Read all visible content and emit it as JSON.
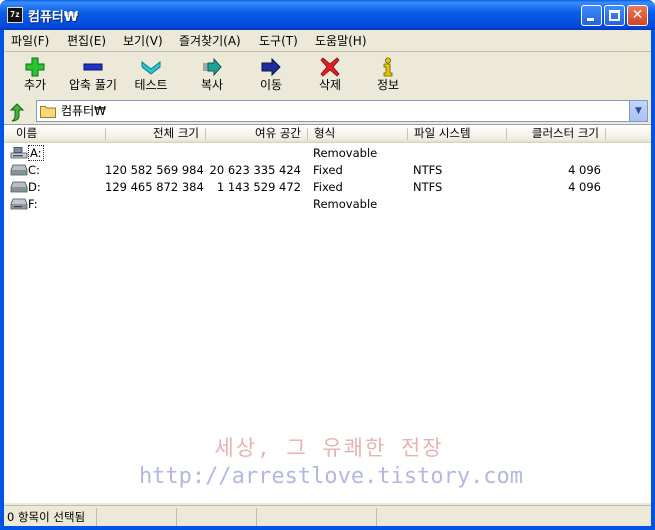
{
  "window": {
    "title": "컴퓨터₩",
    "app_icon_text": "7z"
  },
  "menu": [
    {
      "label": "파일(F)"
    },
    {
      "label": "편집(E)"
    },
    {
      "label": "보기(V)"
    },
    {
      "label": "즐겨찾기(A)"
    },
    {
      "label": "도구(T)"
    },
    {
      "label": "도움말(H)"
    }
  ],
  "toolbar": [
    {
      "label": "추가",
      "icon": "add-icon",
      "color": "#22b02a"
    },
    {
      "label": "압축 풀기",
      "icon": "extract-icon",
      "color": "#1e2fb8"
    },
    {
      "label": "테스트",
      "icon": "test-icon",
      "color": "#19b7c8"
    },
    {
      "label": "복사",
      "icon": "copy-icon",
      "color": "#1a8f86"
    },
    {
      "label": "이동",
      "icon": "move-icon",
      "color": "#1b2a8e"
    },
    {
      "label": "삭제",
      "icon": "delete-icon",
      "color": "#d81e1e"
    },
    {
      "label": "정보",
      "icon": "info-icon",
      "color": "#d8b800"
    }
  ],
  "address": {
    "path": "컴퓨터₩"
  },
  "columns": [
    {
      "label": "이름"
    },
    {
      "label": "전체 크기"
    },
    {
      "label": "여유 공간"
    },
    {
      "label": "형식"
    },
    {
      "label": "파일 시스템"
    },
    {
      "label": "클러스터 크기"
    }
  ],
  "rows": [
    {
      "name": "A:",
      "total": "",
      "free": "",
      "type": "Removable",
      "fs": "",
      "cluster": "",
      "icon": "floppy-drive-icon"
    },
    {
      "name": "C:",
      "total": "120 582 569 984",
      "free": "20 623 335 424",
      "type": "Fixed",
      "fs": "NTFS",
      "cluster": "4 096",
      "icon": "hard-drive-icon"
    },
    {
      "name": "D:",
      "total": "129 465 872 384",
      "free": "1 143 529 472",
      "type": "Fixed",
      "fs": "NTFS",
      "cluster": "4 096",
      "icon": "hard-drive-icon"
    },
    {
      "name": "F:",
      "total": "",
      "free": "",
      "type": "Removable",
      "fs": "",
      "cluster": "",
      "icon": "removable-drive-icon"
    }
  ],
  "watermark": {
    "line1": "세상, 그 유쾌한 전장",
    "line2": "http://arrestlove.tistory.com"
  },
  "status": {
    "text": "0 항목이 선택됨"
  }
}
